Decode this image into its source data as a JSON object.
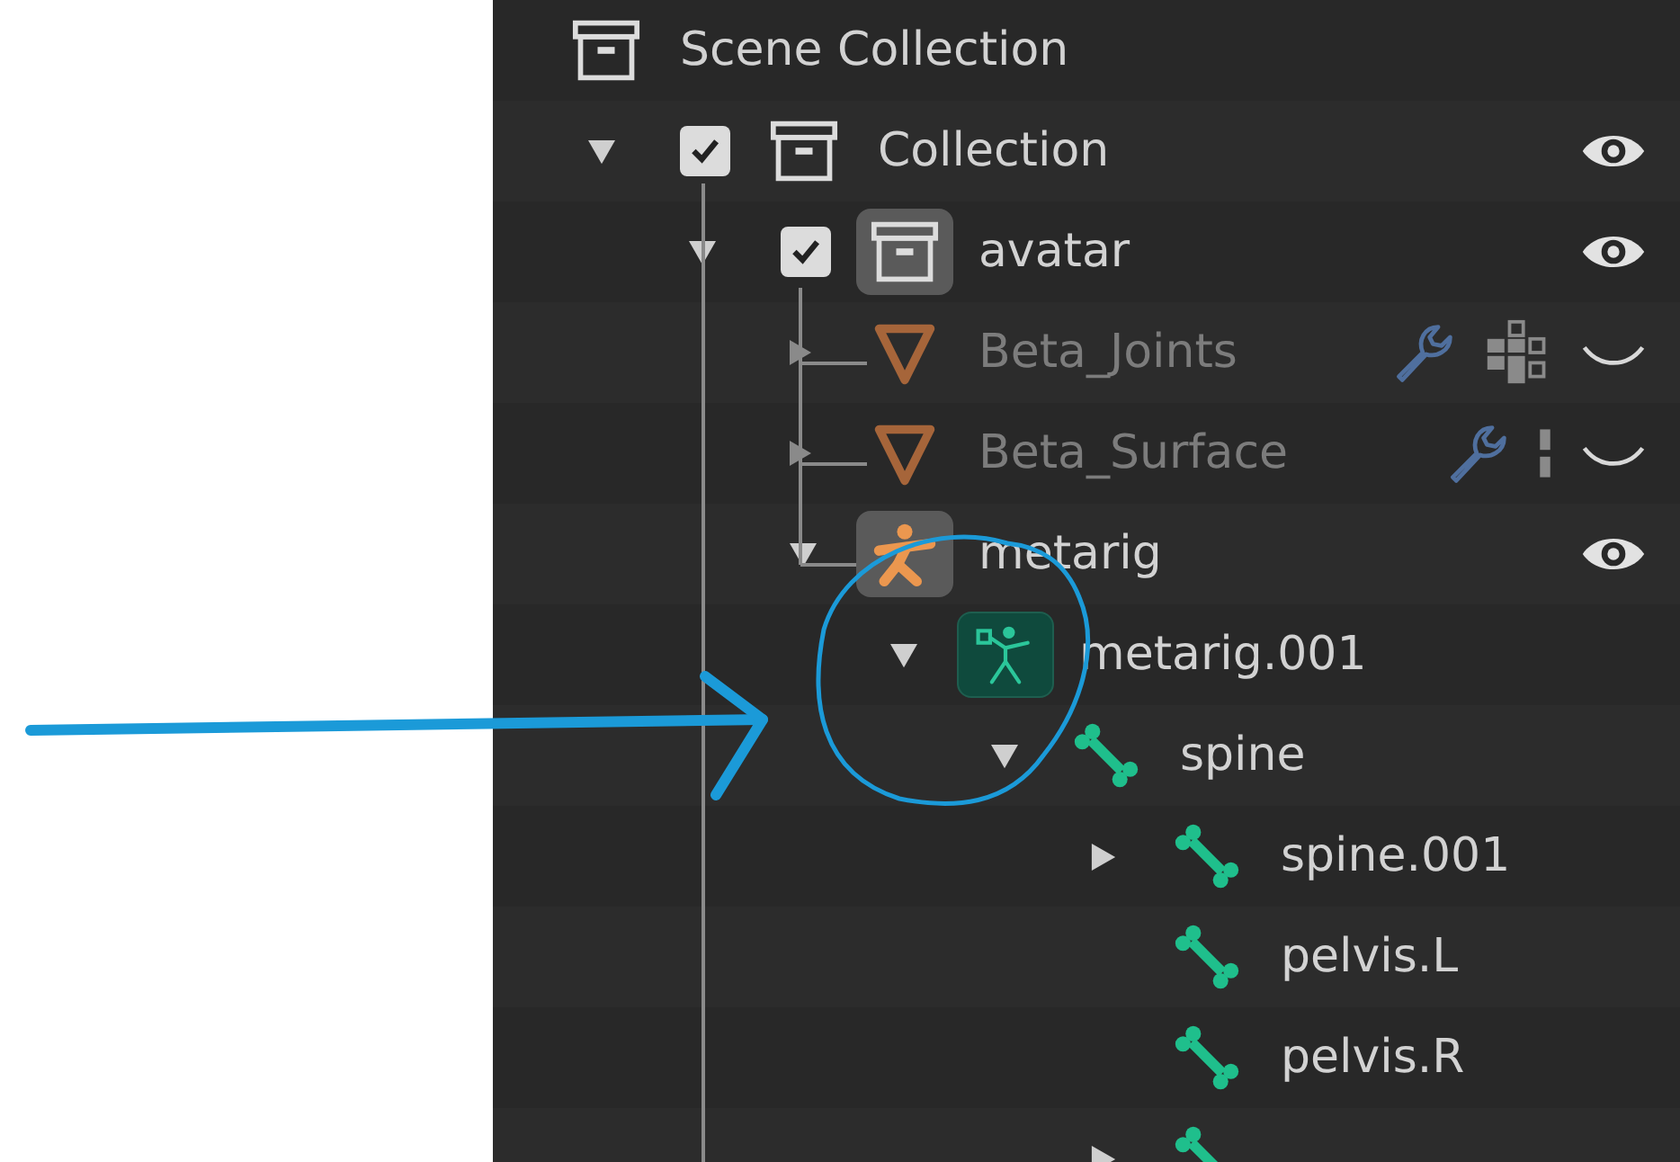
{
  "outliner": {
    "items": [
      {
        "label": "Scene Collection",
        "kind": "collection",
        "children": [
          {
            "label": "Collection",
            "kind": "collection",
            "expanded": true,
            "checked": true,
            "visible": true,
            "children": [
              {
                "label": "avatar",
                "kind": "collection",
                "expanded": true,
                "checked": true,
                "icon_highlight": true,
                "visible": true,
                "children": [
                  {
                    "label": "Beta_Joints",
                    "kind": "mesh",
                    "expanded": false,
                    "disabled": true,
                    "visible": false,
                    "badges": [
                      {
                        "kind": "wrench"
                      },
                      {
                        "kind": "grid"
                      }
                    ]
                  },
                  {
                    "label": "Beta_Surface",
                    "kind": "mesh",
                    "expanded": false,
                    "disabled": true,
                    "visible": false,
                    "badges": [
                      {
                        "kind": "wrench"
                      },
                      {
                        "kind": "bar"
                      }
                    ]
                  },
                  {
                    "label": "metarig",
                    "kind": "armature",
                    "expanded": true,
                    "disabled": false,
                    "icon_highlight": true,
                    "visible": true,
                    "children": [
                      {
                        "label": "metarig.001",
                        "kind": "armature_data",
                        "expanded": true,
                        "icon_highlight": true,
                        "children": [
                          {
                            "label": "spine",
                            "kind": "bone",
                            "expanded": true,
                            "children": [
                              {
                                "label": "spine.001",
                                "kind": "bone",
                                "expanded": false
                              },
                              {
                                "label": "pelvis.L",
                                "kind": "bone"
                              },
                              {
                                "label": "pelvis.R",
                                "kind": "bone"
                              },
                              {
                                "kind": "bone",
                                "expanded": false
                              }
                            ]
                          }
                        ]
                      }
                    ]
                  }
                ]
              }
            ]
          }
        ]
      }
    ]
  }
}
